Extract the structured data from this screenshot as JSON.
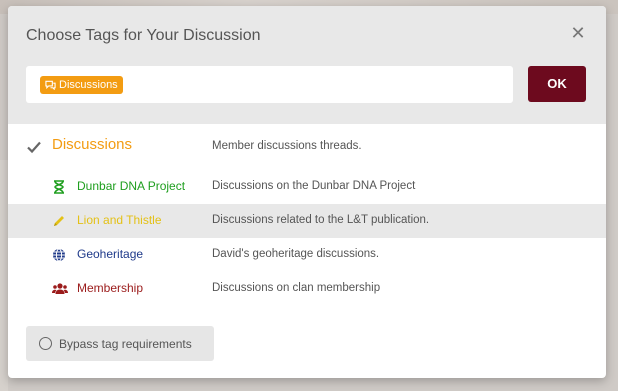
{
  "modal": {
    "title": "Choose Tags for Your Discussion",
    "close_icon": "close-icon",
    "ok_label": "OK"
  },
  "selected_tags": [
    {
      "label": "Discussions",
      "icon": "comments-icon",
      "color": "#f39c12"
    }
  ],
  "tags": [
    {
      "name": "Discussions",
      "description": "Member discussions threads.",
      "color": "#f39c12",
      "icon": "checkmark-icon",
      "selected": true
    },
    {
      "name": "Dunbar DNA Project",
      "description": "Discussions on the Dunbar DNA Project",
      "color": "#1e9e1e",
      "icon": "hourglass-icon"
    },
    {
      "name": "Lion and Thistle",
      "description": "Discussions related to the L&T publication.",
      "color": "#e4c116",
      "icon": "pencil-icon",
      "highlighted": true
    },
    {
      "name": "Geoheritage",
      "description": "David's geoheritage discussions.",
      "color": "#1f3a8a",
      "icon": "globe-icon"
    },
    {
      "name": "Membership",
      "description": "Discussions on clan membership",
      "color": "#9b1b1b",
      "icon": "users-icon"
    }
  ],
  "bypass": {
    "label": "Bypass tag requirements"
  },
  "colors": {
    "ok_button": "#6d0a1e",
    "header_bg": "#e8e8e8"
  }
}
